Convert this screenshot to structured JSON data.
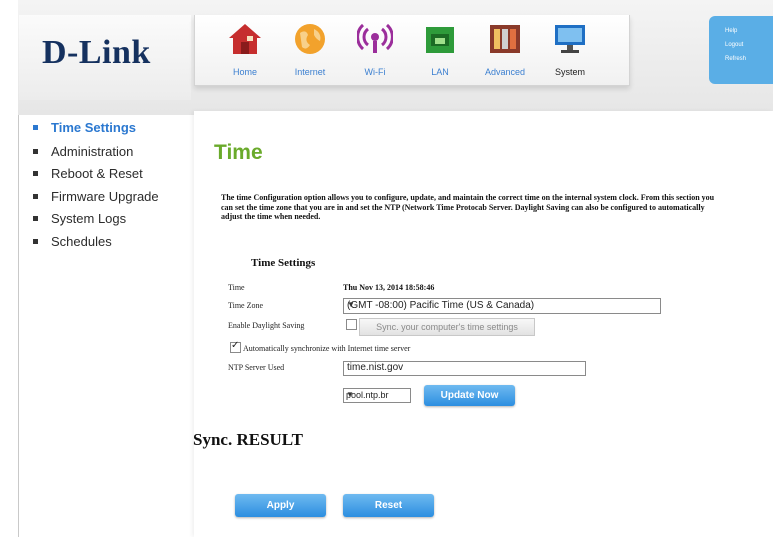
{
  "brand": {
    "logo_text": "D-Link"
  },
  "nav": {
    "items": [
      {
        "label": "Home",
        "icon": "home-icon"
      },
      {
        "label": "Internet",
        "icon": "globe-icon"
      },
      {
        "label": "Wi-Fi",
        "icon": "wifi-icon"
      },
      {
        "label": "LAN",
        "icon": "lan-icon"
      },
      {
        "label": "Advanced",
        "icon": "tools-icon"
      },
      {
        "label": "System",
        "icon": "monitor-icon"
      }
    ],
    "active": "System"
  },
  "quick_links": {
    "help": "Help",
    "logout": "Logout",
    "refresh": "Refresh"
  },
  "sidebar": {
    "items": [
      {
        "label": "Time Settings",
        "active": true
      },
      {
        "label": "Administration"
      },
      {
        "label": "Reboot & Reset"
      },
      {
        "label": "Firmware Upgrade"
      },
      {
        "label": "System Logs"
      },
      {
        "label": "Schedules"
      }
    ]
  },
  "main": {
    "title": "Time",
    "description": "The time Configuration option allows you to configure, update, and maintain the correct time on the internal system clock. From this section you can set the time zone that you are in and set the NTP (Network Time Protocab Server. Daylight Saving can also be configured to automatically adjust the time when needed.",
    "section_title": "Time Settings",
    "time_label": "Time",
    "time_value": "Thu Nov 13, 2014 18:58:46",
    "timezone_label": "Time Zone",
    "timezone_value": "(GMT -08:00) Pacific Time (US & Canada)",
    "daylight_label": "Enable Daylight Saving",
    "sync_button": "Sync. your computer's time settings",
    "auto_sync_label": "Automatically synchronize with Internet time server",
    "ntp_label": "NTP Server Used",
    "ntp_value": "time.nist.gov",
    "ntp_select_value": "pool.ntp.br",
    "update_button": "Update Now",
    "result_text": "Sync. RESULT",
    "apply_button": "Apply",
    "reset_button": "Reset"
  },
  "colors": {
    "title_green": "#6aaa2b",
    "link_blue": "#2b78d0",
    "button_blue": "#2c8ee0",
    "logo_navy": "#15315f"
  }
}
